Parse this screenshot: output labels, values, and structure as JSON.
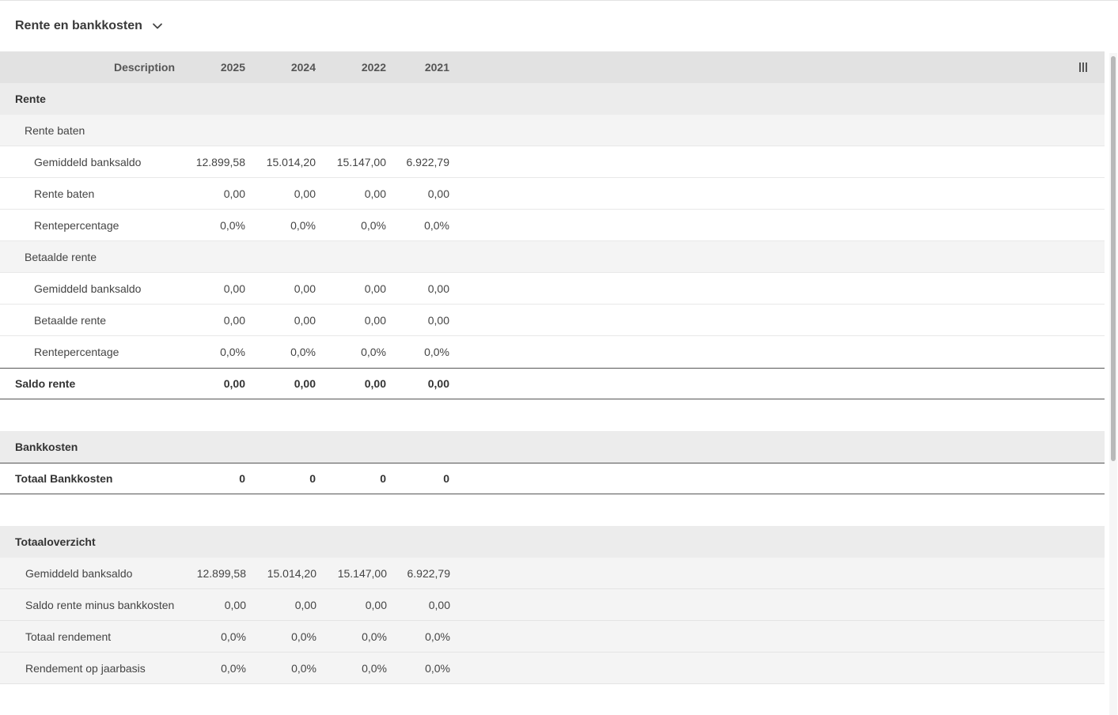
{
  "header": {
    "title": "Rente en bankkosten"
  },
  "columns": {
    "description": "Description",
    "years": [
      "2025",
      "2024",
      "2022",
      "2021"
    ]
  },
  "sections": {
    "rente": {
      "label": "Rente",
      "baten": {
        "label": "Rente baten",
        "rows": [
          {
            "label": "Gemiddeld banksaldo",
            "values": [
              "12.899,58",
              "15.014,20",
              "15.147,00",
              "6.922,79"
            ]
          },
          {
            "label": "Rente baten",
            "values": [
              "0,00",
              "0,00",
              "0,00",
              "0,00"
            ]
          },
          {
            "label": "Rentepercentage",
            "values": [
              "0,0%",
              "0,0%",
              "0,0%",
              "0,0%"
            ]
          }
        ]
      },
      "betaald": {
        "label": "Betaalde rente",
        "rows": [
          {
            "label": "Gemiddeld banksaldo",
            "values": [
              "0,00",
              "0,00",
              "0,00",
              "0,00"
            ]
          },
          {
            "label": "Betaalde rente",
            "values": [
              "0,00",
              "0,00",
              "0,00",
              "0,00"
            ]
          },
          {
            "label": "Rentepercentage",
            "values": [
              "0,0%",
              "0,0%",
              "0,0%",
              "0,0%"
            ]
          }
        ]
      },
      "total": {
        "label": "Saldo rente",
        "values": [
          "0,00",
          "0,00",
          "0,00",
          "0,00"
        ]
      }
    },
    "bankkosten": {
      "label": "Bankkosten",
      "total": {
        "label": "Totaal Bankkosten",
        "values": [
          "0",
          "0",
          "0",
          "0"
        ]
      }
    },
    "totaal": {
      "label": "Totaaloverzicht",
      "rows": [
        {
          "label": "Gemiddeld banksaldo",
          "values": [
            "12.899,58",
            "15.014,20",
            "15.147,00",
            "6.922,79"
          ]
        },
        {
          "label": "Saldo rente minus bankkosten",
          "values": [
            "0,00",
            "0,00",
            "0,00",
            "0,00"
          ]
        },
        {
          "label": "Totaal rendement",
          "values": [
            "0,0%",
            "0,0%",
            "0,0%",
            "0,0%"
          ]
        },
        {
          "label": "Rendement op jaarbasis",
          "values": [
            "0,0%",
            "0,0%",
            "0,0%",
            "0,0%"
          ]
        }
      ]
    }
  },
  "icons": {
    "header_toggle": "chevron-down-icon",
    "column_chooser": "columns-icon"
  }
}
